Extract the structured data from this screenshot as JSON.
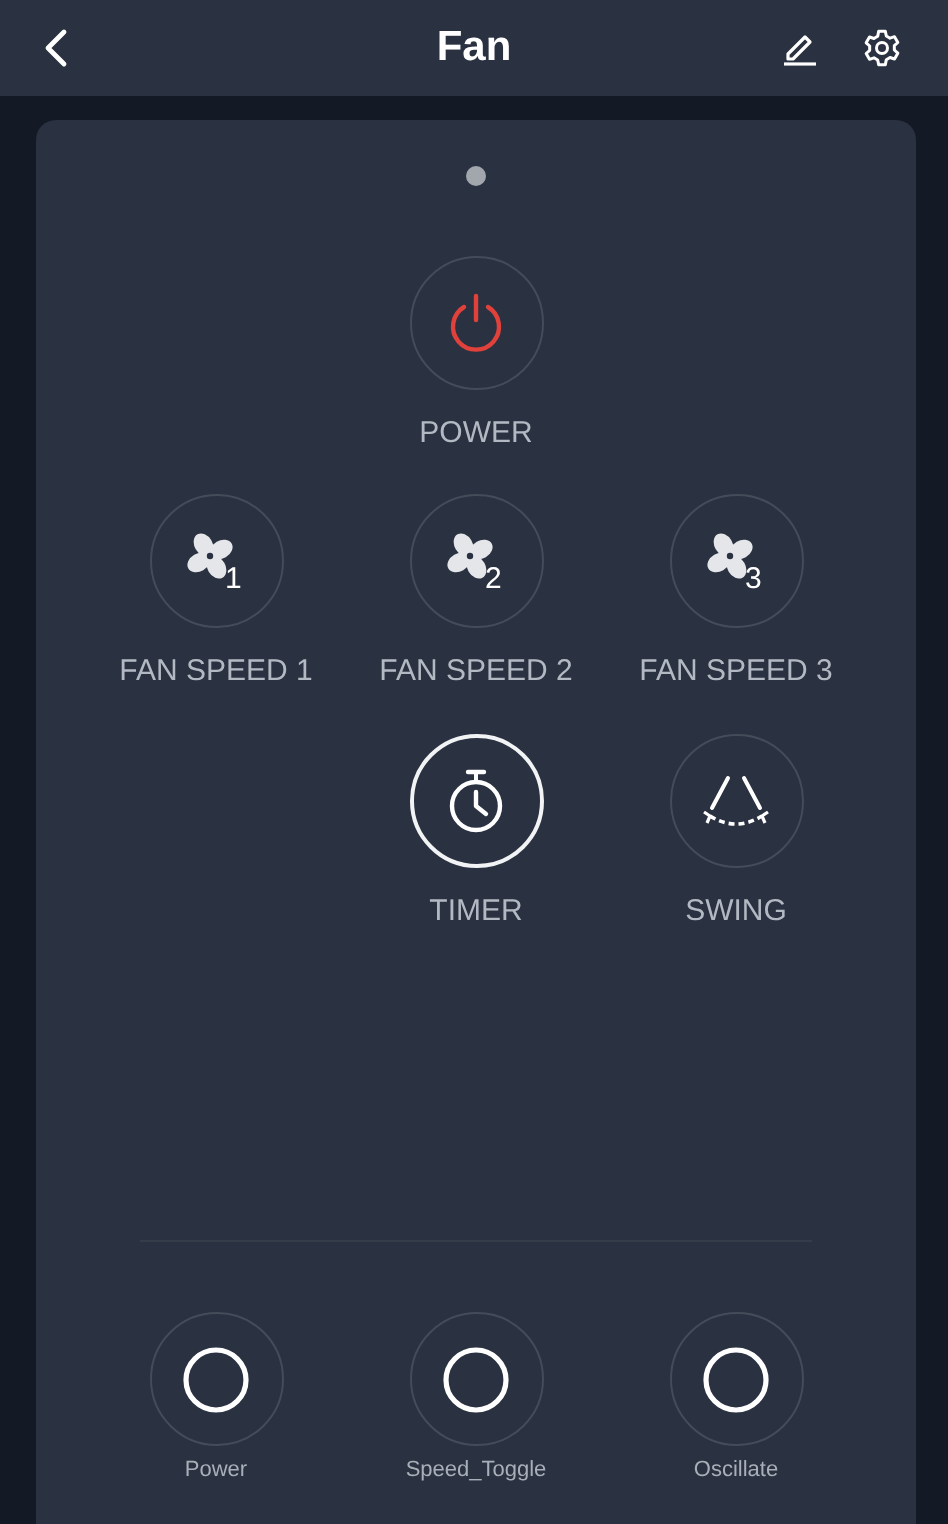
{
  "header": {
    "title": "Fan"
  },
  "page_indicator": [
    {
      "selected": true
    }
  ],
  "keys": [
    {
      "kind": "blank"
    },
    {
      "kind": "power",
      "label": "POWER",
      "highlighted": false
    },
    {
      "kind": "blank"
    },
    {
      "kind": "fan",
      "badge": "1",
      "label": "FAN SPEED 1",
      "highlighted": false
    },
    {
      "kind": "fan",
      "badge": "2",
      "label": "FAN SPEED 2",
      "highlighted": false
    },
    {
      "kind": "fan",
      "badge": "3",
      "label": "FAN SPEED 3",
      "highlighted": false
    },
    {
      "kind": "blank"
    },
    {
      "kind": "timer",
      "label": "TIMER",
      "highlighted": true
    },
    {
      "kind": "swing",
      "label": "SWING",
      "highlighted": false
    }
  ],
  "custom_keys": [
    {
      "label": "Power"
    },
    {
      "label": "Speed_Toggle"
    },
    {
      "label": "Oscillate"
    }
  ]
}
